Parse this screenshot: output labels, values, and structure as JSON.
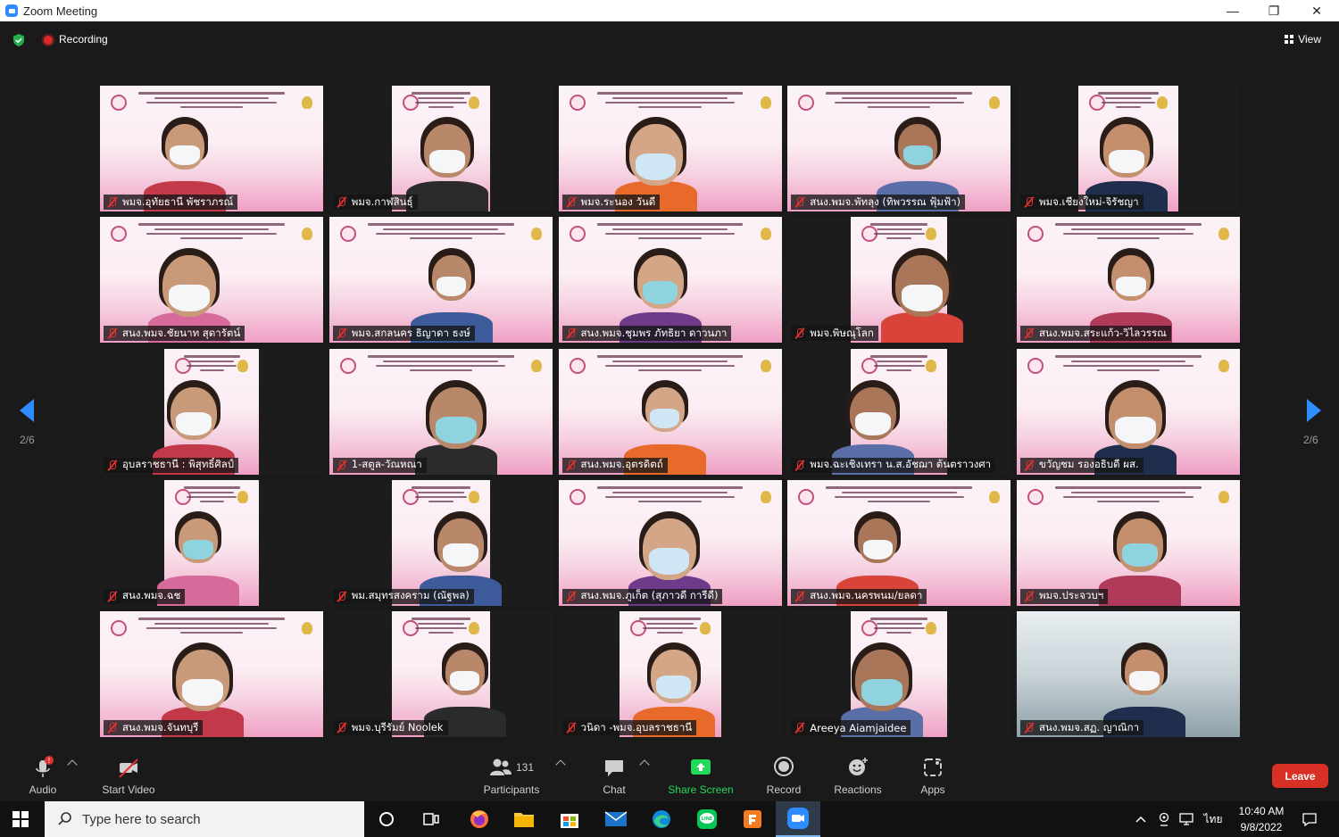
{
  "window": {
    "title": "Zoom Meeting",
    "controls": [
      "—",
      "❐",
      "✕"
    ]
  },
  "top_bar": {
    "recording_label": "Recording",
    "view_label": "View"
  },
  "paging": {
    "left_page": "2/6",
    "right_page": "2/6"
  },
  "tiles": [
    {
      "name": "พมจ.อุทัยธานี พัชราภรณ์",
      "style": "slide"
    },
    {
      "name": "พมจ.กาฬสินธุ์",
      "style": "dark"
    },
    {
      "name": "พมจ.ระนอง วันดี",
      "style": "slide"
    },
    {
      "name": "สนง.พมจ.พัทลุง (ทิพวรรณ ฟุ้มฟ้า)",
      "style": "slide"
    },
    {
      "name": "พมจ.เชียงใหม่-จิรัชญา",
      "style": "dark"
    },
    {
      "name": "สนง.พมจ.ชัยนาท สุดารัตน์",
      "style": "slide"
    },
    {
      "name": "พมจ.สกลนคร ธิญาดา  ธงษ์",
      "style": "slide"
    },
    {
      "name": "สนง.พมจ.ชุมพร ภัทธิยา ดาวนภา",
      "style": "slide"
    },
    {
      "name": "พมจ.พิษณุโลก",
      "style": "dark"
    },
    {
      "name": "สนง.พมจ.สระแก้ว-วิไลวรรณ",
      "style": "slide"
    },
    {
      "name": "อุบลราชธานี : พิสุทธิ์ศิลป์",
      "style": "dark"
    },
    {
      "name": "1-สตูล-วัณหณา",
      "style": "slide"
    },
    {
      "name": "สนง.พมจ.อุตรดิตถ์",
      "style": "slide"
    },
    {
      "name": "พมจ.ฉะเชิงเทรา น.ส.อัชฌา ต้นตราวงศา",
      "style": "dark"
    },
    {
      "name": "ขวัญชม รองอธิบดี ผส.",
      "style": "slide"
    },
    {
      "name": "สนง.พมจ.ฉช",
      "style": "dark"
    },
    {
      "name": "พม.สมุทรสงคราม (ณัฐพล)",
      "style": "dark"
    },
    {
      "name": "สนง.พมจ.ภูเก็ต (สุภาวดี การีดี)",
      "style": "slide"
    },
    {
      "name": "สนง.พมจ.นครพนม/ยลดา",
      "style": "slide"
    },
    {
      "name": "พมจ.ประจวบฯ",
      "style": "slide"
    },
    {
      "name": "สนง.พมจ.จันทบุรี",
      "style": "slide"
    },
    {
      "name": "พมจ.บุรีรัมย์ Noolek",
      "style": "dark"
    },
    {
      "name": "วนิดา -พมจ.อุบลราชธานี",
      "style": "dark"
    },
    {
      "name": "Areeya Aiamjaidee",
      "style": "dark"
    },
    {
      "name": "สนง.พมจ.สฏ. ญาณิกา",
      "style": "office"
    }
  ],
  "toolbar": {
    "audio": "Audio",
    "start_video": "Start Video",
    "participants_label": "Participants",
    "participants_count": "131",
    "chat": "Chat",
    "share_screen": "Share Screen",
    "record": "Record",
    "reactions": "Reactions",
    "apps": "Apps",
    "leave": "Leave",
    "audio_alert": "!"
  },
  "taskbar": {
    "search_placeholder": "Type here to search",
    "time": "10:40 AM",
    "date": "9/8/2022",
    "ime": "ไทย"
  },
  "colors": {
    "share_green": "#23d959",
    "leave_red": "#d93025",
    "mic_off_red": "#e0312f",
    "accent_blue": "#2d8cff"
  }
}
